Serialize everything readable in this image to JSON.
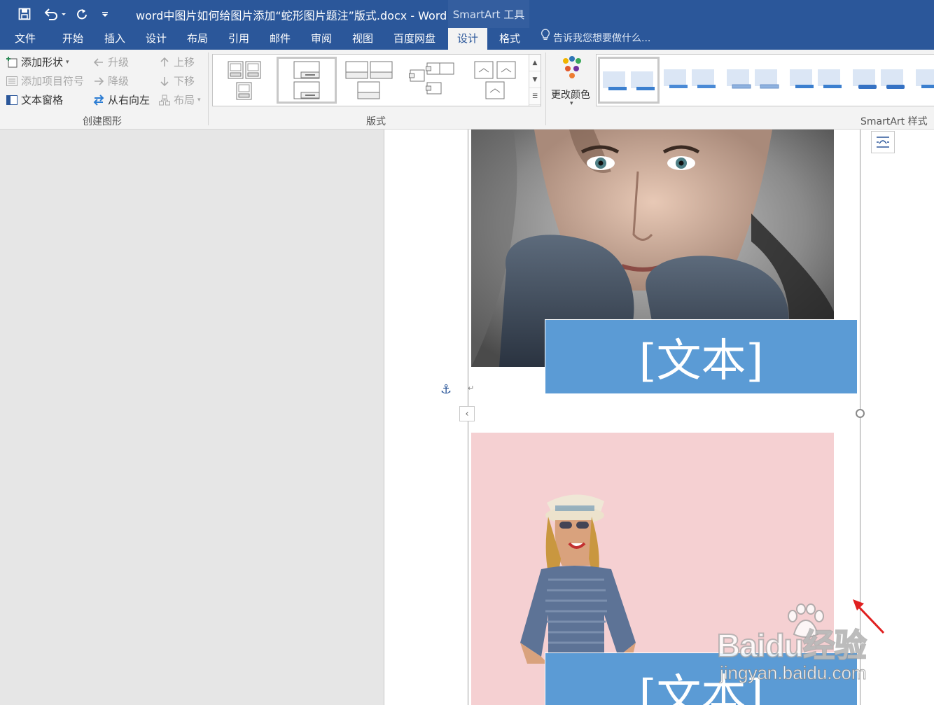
{
  "window": {
    "title": "word中图片如何给图片添加“蛇形图片题注”版式.docx - Word",
    "context_tab_group": "SmartArt 工具"
  },
  "quick_access": [
    "save-icon",
    "undo-icon",
    "redo-icon",
    "customize-icon"
  ],
  "tabs": [
    {
      "label": "文件"
    },
    {
      "label": "开始"
    },
    {
      "label": "插入"
    },
    {
      "label": "设计"
    },
    {
      "label": "布局"
    },
    {
      "label": "引用"
    },
    {
      "label": "邮件"
    },
    {
      "label": "审阅"
    },
    {
      "label": "视图"
    },
    {
      "label": "百度网盘"
    },
    {
      "label": "设计",
      "active": true
    },
    {
      "label": "格式"
    }
  ],
  "tell_me": "告诉我您想要做什么...",
  "ribbon": {
    "create_graphic": {
      "label": "创建图形",
      "add_shape": "添加形状",
      "add_bullet": "添加项目符号",
      "text_pane": "文本窗格",
      "promote": "升级",
      "demote": "降级",
      "right_to_left": "从右向左",
      "move_up": "上移",
      "move_down": "下移",
      "layout": "布局"
    },
    "layouts": {
      "label": "版式"
    },
    "change_colors": "更改颜色",
    "smartart_styles": {
      "label": "SmartArt 样式"
    }
  },
  "document": {
    "caption_1": "[文本]",
    "caption_2": "[文本]"
  },
  "watermark": {
    "brand": "Baidu经验",
    "url": "jingyan.baidu.com"
  },
  "colors": {
    "titlebar": "#2b579a",
    "caption_fill": "#5b9bd5",
    "pink_background": "#f5d0d2",
    "annotation_arrow": "#e02020"
  }
}
